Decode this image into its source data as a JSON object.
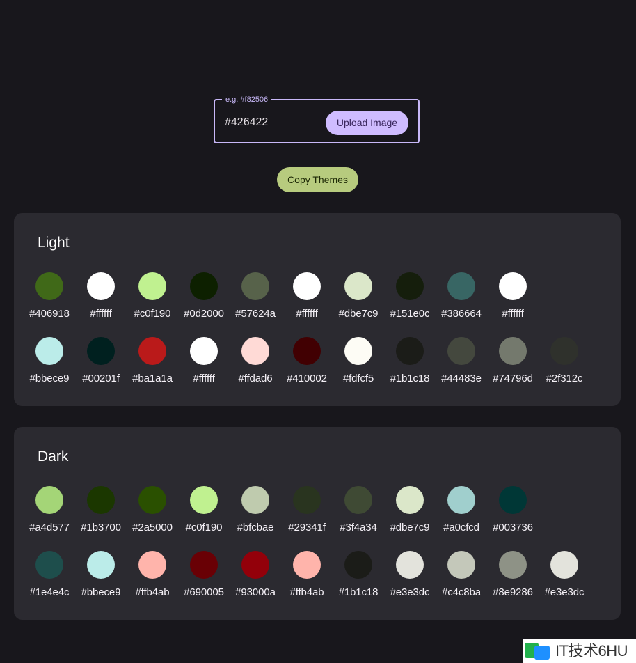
{
  "input": {
    "legend": "e.g. #f82506",
    "value": "#426422",
    "upload_label": "Upload Image"
  },
  "copy_button_label": "Copy Themes",
  "light": {
    "title": "Light",
    "row1": [
      "#406918",
      "#ffffff",
      "#c0f190",
      "#0d2000",
      "#57624a",
      "#ffffff",
      "#dbe7c9",
      "#151e0c",
      "#386664",
      "#ffffff"
    ],
    "row2": [
      "#bbece9",
      "#00201f",
      "#ba1a1a",
      "#ffffff",
      "#ffdad6",
      "#410002",
      "#fdfcf5",
      "#1b1c18",
      "#44483e",
      "#74796d",
      "#2f312c"
    ]
  },
  "dark": {
    "title": "Dark",
    "row1": [
      "#a4d577",
      "#1b3700",
      "#2a5000",
      "#c0f190",
      "#bfcbae",
      "#29341f",
      "#3f4a34",
      "#dbe7c9",
      "#a0cfcd",
      "#003736"
    ],
    "row2": [
      "#1e4e4c",
      "#bbece9",
      "#ffb4ab",
      "#690005",
      "#93000a",
      "#ffb4ab",
      "#1b1c18",
      "#e3e3dc",
      "#c4c8ba",
      "#8e9286",
      "#e3e3dc"
    ]
  },
  "watermark": "IT技术6HU"
}
